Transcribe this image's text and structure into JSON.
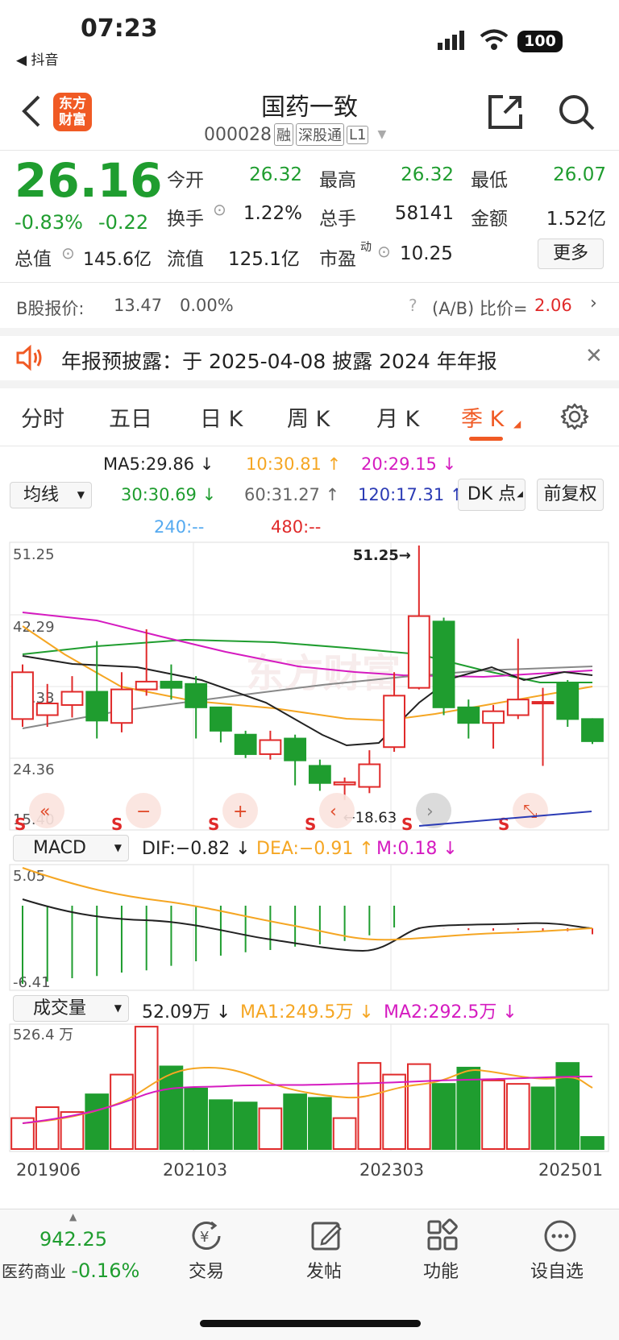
{
  "status": {
    "time": "07:23",
    "back_app": "◀ 抖音",
    "battery": "100"
  },
  "header": {
    "title": "国药一致",
    "code": "000028",
    "tags": [
      "融",
      "深股通",
      "L1"
    ],
    "logo": "东方\n财富"
  },
  "quote": {
    "price": "26.16",
    "change_pct": "-0.83%",
    "change": "-0.22",
    "stats": [
      {
        "label": "今开",
        "value": "26.32",
        "color": "#1f9d2f"
      },
      {
        "label": "最高",
        "value": "26.32",
        "color": "#1f9d2f"
      },
      {
        "label": "最低",
        "value": "26.07",
        "color": "#1f9d2f"
      },
      {
        "label": "换手",
        "value": "1.22%",
        "color": "#222222"
      },
      {
        "label": "总手",
        "value": "58141",
        "color": "#222222"
      },
      {
        "label": "金额",
        "value": "1.52亿",
        "color": "#222222"
      }
    ],
    "zongzhi_label": "总值",
    "zongzhi": "145.6亿",
    "liuzhi_label": "流值",
    "liuzhi": "125.1亿",
    "shiying_label": "市盈",
    "shiying_sup": "动",
    "shiying": "10.25",
    "more": "更多"
  },
  "bshare": {
    "label": "B股报价:",
    "price": "13.47",
    "pct": "0.00%",
    "ratio_label": "(A/B) 比价=",
    "ratio": "2.06"
  },
  "notice": {
    "text": "年报预披露：于 2025-04-08 披露 2024 年年报"
  },
  "tabs": [
    "分时",
    "五日",
    "日 K",
    "周 K",
    "月 K",
    "季 K"
  ],
  "ma": {
    "selector": "均线",
    "ma5": "MA5:29.86 ↓",
    "ma10": "10:30.81 ↑",
    "ma20": "20:29.15 ↓",
    "ma30": "30:30.69 ↓",
    "ma60": "60:31.27 ↑",
    "ma120": "120:17.31 ↑",
    "ma240": "240:--",
    "ma480": "480:--",
    "dk": "DK 点",
    "fq": "前复权"
  },
  "price_chart": {
    "y_labels": [
      "51.25",
      "42.29",
      "33.33",
      "24.36",
      "15.40"
    ],
    "max_label": "51.25→",
    "min_label": "←18.63",
    "watermark": "东方财富",
    "s_marker": "S"
  },
  "macd": {
    "selector": "MACD",
    "dif": "DIF:−0.82 ↓",
    "dea": "DEA:−0.91 ↑",
    "m": "M:0.18 ↓",
    "top": "5.05",
    "bottom": "-6.41"
  },
  "volume": {
    "selector": "成交量",
    "value": "52.09万 ↓",
    "ma1": "MA1:249.5万 ↓",
    "ma2": "MA2:292.5万 ↓",
    "top": "526.4 万"
  },
  "x_labels": [
    "201906",
    "202103",
    "202303",
    "202501"
  ],
  "chart_data": {
    "type": "candlestick",
    "period": "quarterly",
    "ylim": [
      15.4,
      51.25
    ],
    "candles": [
      {
        "o": 29.0,
        "c": 35.0,
        "h": 36.0,
        "l": 28.0
      },
      {
        "o": 29.5,
        "c": 31.0,
        "h": 33.5,
        "l": 28.0
      },
      {
        "o": 30.8,
        "c": 32.5,
        "h": 34.5,
        "l": 29.2
      },
      {
        "o": 32.5,
        "c": 28.8,
        "h": 39.0,
        "l": 26.5
      },
      {
        "o": 28.5,
        "c": 32.8,
        "h": 35.0,
        "l": 27.3
      },
      {
        "o": 32.8,
        "c": 33.8,
        "h": 40.5,
        "l": 32.0
      },
      {
        "o": 33.8,
        "c": 33.0,
        "h": 36.0,
        "l": 31.5
      },
      {
        "o": 33.5,
        "c": 30.5,
        "h": 34.5,
        "l": 26.5
      },
      {
        "o": 30.5,
        "c": 27.5,
        "h": 29.8,
        "l": 26.0
      },
      {
        "o": 27.0,
        "c": 24.5,
        "h": 27.5,
        "l": 24.0
      },
      {
        "o": 24.5,
        "c": 26.3,
        "h": 27.5,
        "l": 23.8
      },
      {
        "o": 26.5,
        "c": 23.7,
        "h": 27.0,
        "l": 20.5
      },
      {
        "o": 23.0,
        "c": 20.8,
        "h": 23.8,
        "l": 19.8
      },
      {
        "o": 20.6,
        "c": 20.9,
        "h": 21.5,
        "l": 18.63
      },
      {
        "o": 20.3,
        "c": 23.2,
        "h": 25.0,
        "l": 19.5
      },
      {
        "o": 25.4,
        "c": 32.0,
        "h": 35.0,
        "l": 24.8
      },
      {
        "o": 33.0,
        "c": 42.2,
        "h": 51.25,
        "l": 32.8
      },
      {
        "o": 41.5,
        "c": 30.5,
        "h": 42.0,
        "l": 29.5
      },
      {
        "o": 30.5,
        "c": 28.5,
        "h": 31.5,
        "l": 26.5
      },
      {
        "o": 28.5,
        "c": 30.0,
        "h": 30.8,
        "l": 25.2
      },
      {
        "o": 29.5,
        "c": 31.5,
        "h": 39.3,
        "l": 29.0
      },
      {
        "o": 31.0,
        "c": 31.2,
        "h": 33.0,
        "l": 23.0
      },
      {
        "o": 33.5,
        "c": 29.0,
        "h": 34.0,
        "l": 28.0
      },
      {
        "o": 29.0,
        "c": 26.16,
        "h": 29.1,
        "l": 25.8
      }
    ],
    "macd_bars": [
      -5.5,
      -5.3,
      -5.0,
      -4.8,
      -4.5,
      -4.3,
      -3.9,
      -3.5,
      -3.0,
      -2.7,
      -2.5,
      -2.2,
      -2.0,
      -1.7,
      -1.2,
      -0.5,
      0.8,
      0.7,
      0.55,
      0.5,
      0.55,
      0.5,
      0.45,
      0.18
    ],
    "volume": [
      133,
      180,
      159,
      235,
      320,
      526,
      355,
      260,
      210,
      200,
      175,
      235,
      220,
      133,
      370,
      320,
      365,
      280,
      350,
      295,
      280,
      265,
      370,
      52.09
    ],
    "volume_up": [
      true,
      true,
      true,
      false,
      true,
      true,
      false,
      false,
      false,
      false,
      true,
      false,
      false,
      true,
      true,
      true,
      true,
      false,
      false,
      true,
      true,
      false,
      false,
      false
    ]
  }
}
